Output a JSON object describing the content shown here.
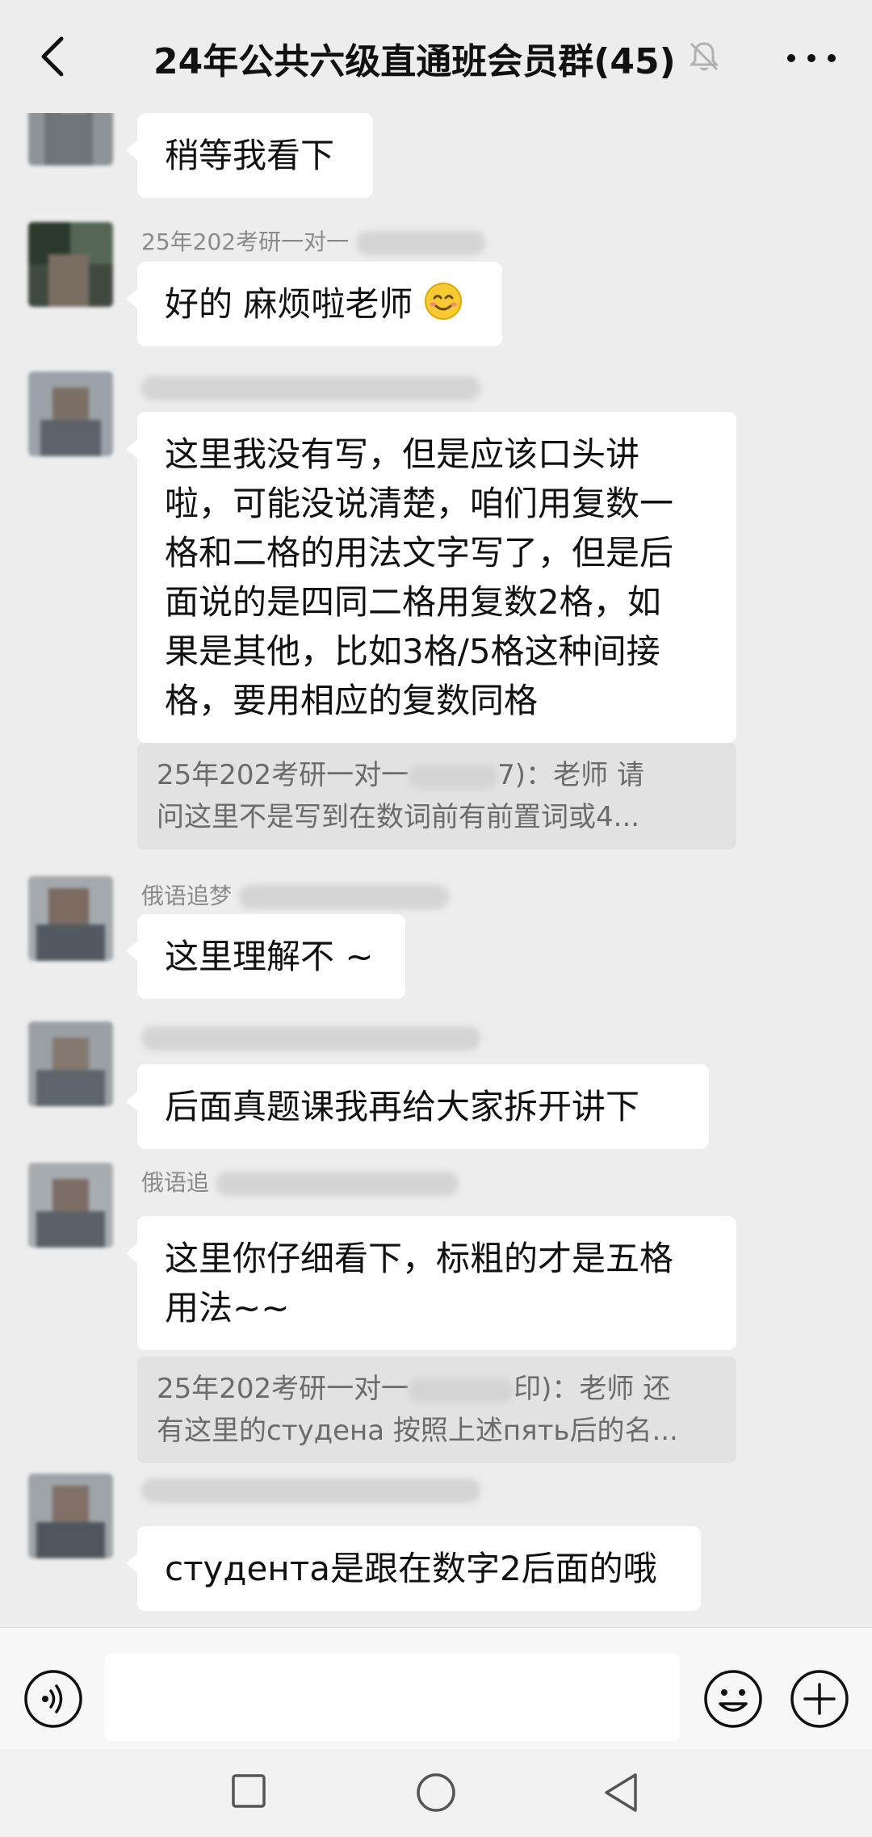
{
  "header": {
    "title": "24年公共六级直通班会员群(45)",
    "back_icon": "chevron-left-icon",
    "mute_icon": "bell-muted-icon",
    "more_icon": "more-dots-icon"
  },
  "messages": [
    {
      "name_visible": "",
      "text": "稍等我看下"
    },
    {
      "name_visible": "25年202考研一对一",
      "text": "好的 麻烦啦老师"
    },
    {
      "name_visible": "",
      "lines": [
        "这里我没有写，但是应该口头讲",
        "啦，可能没说清楚，咱们用复数一",
        "格和二格的用法文字写了，但是后",
        "面说的是四同二格用复数2格，如",
        "果是其他，比如3格/5格这种间接",
        "格，要用相应的复数同格"
      ],
      "quote": {
        "prefix": "25年202考研一对一",
        "suffix": "7)：老师 请",
        "line2": "问这里不是写到在数词前有前置词或4..."
      }
    },
    {
      "name_visible": "俄语追梦",
      "text": "这里理解不 ~"
    },
    {
      "name_visible": "",
      "text": "后面真题课我再给大家拆开讲下"
    },
    {
      "name_visible": "俄语追",
      "lines": [
        "这里你仔细看下，标粗的才是五格",
        "用法~~"
      ],
      "quote": {
        "prefix": "25年202考研一对一",
        "suffix": "印)：老师 还",
        "line2": "有这里的студена 按照上述пять后的名..."
      }
    },
    {
      "name_visible": "",
      "text": "студента是跟在数字2后面的哦"
    }
  ],
  "input_bar": {
    "voice_icon": "voice-icon",
    "emoji_icon": "emoji-icon",
    "plus_icon": "plus-icon",
    "input_value": ""
  },
  "nav": {
    "recent_icon": "square-icon",
    "home_icon": "circle-icon",
    "back_icon": "triangle-back-icon"
  },
  "colors": {
    "background": "#ededed",
    "bubble": "#ffffff",
    "quote_bg": "#e2e2e2",
    "name_text": "#8a8a8a"
  }
}
